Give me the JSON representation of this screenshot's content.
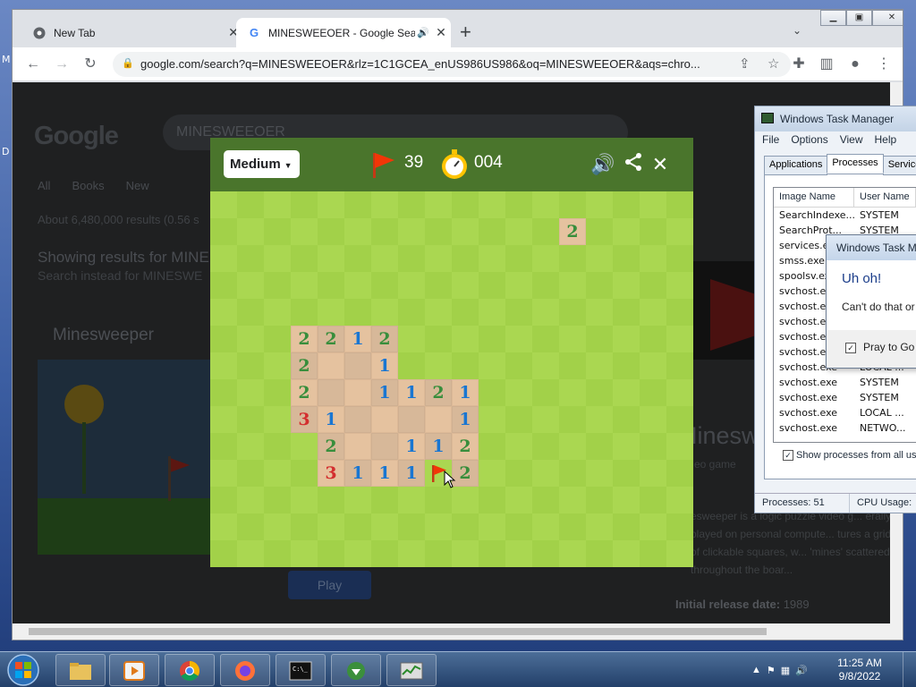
{
  "desktop": {
    "label_1": "M",
    "label_2": "D"
  },
  "browser": {
    "tabs": [
      {
        "title": "New Tab"
      },
      {
        "title": "MINESWEEOER - Google Sea"
      }
    ],
    "url": "google.com/search?q=MINESWEEOER&rlz=1C1GCEA_enUS986US986&oq=MINESWEEOER&aqs=chro..."
  },
  "google": {
    "logo": "Google",
    "query": "MINESWEEOER",
    "tabs": [
      "All",
      "Books",
      "New"
    ],
    "results_count": "About 6,480,000 results (0.56 s",
    "showing": "Showing results for MINE",
    "search_instead": "Search instead for MINESWE",
    "feature_title": "Minesweeper",
    "play_label": "Play",
    "panel_title": "Mineswe",
    "panel_subtitle": "eo game",
    "panel_text": "esweeper is a logic puzzle video g... erally played on personal compute... tures a grid of clickable squares, w... 'mines' scattered throughout the boar...",
    "release_label": "Initial release date:",
    "release_value": "1989"
  },
  "game": {
    "difficulty": "Medium",
    "flags_remaining": "39",
    "timer": "004",
    "colors": {
      "header": "#4a752c",
      "light_green": "#aad751",
      "dark_green": "#a2d149",
      "light_tan": "#e5c29f",
      "dark_tan": "#d7b899",
      "one": "#1976d2",
      "two": "#388e3c",
      "three": "#d32f2f",
      "flag": "#f23607"
    },
    "rows": 14,
    "cols": 18,
    "revealed": [
      {
        "r": 1,
        "c": 13,
        "n": 2
      },
      {
        "r": 5,
        "c": 3,
        "n": 2
      },
      {
        "r": 5,
        "c": 4,
        "n": 2
      },
      {
        "r": 5,
        "c": 5,
        "n": 1
      },
      {
        "r": 5,
        "c": 6,
        "n": 2
      },
      {
        "r": 6,
        "c": 3,
        "n": 2
      },
      {
        "r": 6,
        "c": 4,
        "n": 0
      },
      {
        "r": 6,
        "c": 5,
        "n": 0
      },
      {
        "r": 6,
        "c": 6,
        "n": 1
      },
      {
        "r": 7,
        "c": 3,
        "n": 2
      },
      {
        "r": 7,
        "c": 4,
        "n": 0
      },
      {
        "r": 7,
        "c": 5,
        "n": 0
      },
      {
        "r": 7,
        "c": 6,
        "n": 1
      },
      {
        "r": 7,
        "c": 7,
        "n": 1
      },
      {
        "r": 7,
        "c": 8,
        "n": 2
      },
      {
        "r": 7,
        "c": 9,
        "n": 1
      },
      {
        "r": 8,
        "c": 3,
        "n": 3
      },
      {
        "r": 8,
        "c": 4,
        "n": 1
      },
      {
        "r": 8,
        "c": 5,
        "n": 0
      },
      {
        "r": 8,
        "c": 6,
        "n": 0
      },
      {
        "r": 8,
        "c": 7,
        "n": 0
      },
      {
        "r": 8,
        "c": 8,
        "n": 0
      },
      {
        "r": 8,
        "c": 9,
        "n": 1
      },
      {
        "r": 9,
        "c": 4,
        "n": 2
      },
      {
        "r": 9,
        "c": 5,
        "n": 0
      },
      {
        "r": 9,
        "c": 6,
        "n": 0
      },
      {
        "r": 9,
        "c": 7,
        "n": 1
      },
      {
        "r": 9,
        "c": 8,
        "n": 1
      },
      {
        "r": 9,
        "c": 9,
        "n": 2
      },
      {
        "r": 10,
        "c": 4,
        "n": 3
      },
      {
        "r": 10,
        "c": 5,
        "n": 1
      },
      {
        "r": 10,
        "c": 6,
        "n": 1
      },
      {
        "r": 10,
        "c": 7,
        "n": 1
      },
      {
        "r": 10,
        "c": 9,
        "n": 2
      }
    ],
    "flags": [
      {
        "r": 10,
        "c": 8
      }
    ]
  },
  "taskmanager": {
    "title": "Windows Task Manager",
    "menu": [
      "File",
      "Options",
      "View",
      "Help"
    ],
    "tabs": [
      "Applications",
      "Processes",
      "Service"
    ],
    "columns": [
      "Image Name",
      "User Name"
    ],
    "rows": [
      [
        "SearchIndexe...",
        "SYSTEM"
      ],
      [
        "SearchProt...",
        "SYSTEM"
      ],
      [
        "services.exe",
        ""
      ],
      [
        "smss.exe",
        ""
      ],
      [
        "spoolsv.exe",
        ""
      ],
      [
        "svchost.exe",
        ""
      ],
      [
        "svchost.exe",
        ""
      ],
      [
        "svchost.exe",
        ""
      ],
      [
        "svchost.exe",
        ""
      ],
      [
        "svchost.exe",
        ""
      ],
      [
        "svchost.exe",
        "LOCAL ..."
      ],
      [
        "svchost.exe",
        "SYSTEM"
      ],
      [
        "svchost.exe",
        "SYSTEM"
      ],
      [
        "svchost.exe",
        "LOCAL ..."
      ],
      [
        "svchost.exe",
        "NETWO..."
      ]
    ],
    "show_all": "Show processes from all use",
    "processes": "Processes: 51",
    "cpu": "CPU Usage: "
  },
  "dialog": {
    "title": "Windows Task M",
    "heading": "Uh oh!",
    "message": "Can't do that or",
    "option": "Pray to Go"
  },
  "taskbar": {
    "time": "11:25 AM",
    "date": "9/8/2022",
    "items": [
      "file-explorer",
      "media-player",
      "chrome",
      "firefox",
      "command-prompt",
      "internet-download-manager",
      "task-manager"
    ]
  }
}
